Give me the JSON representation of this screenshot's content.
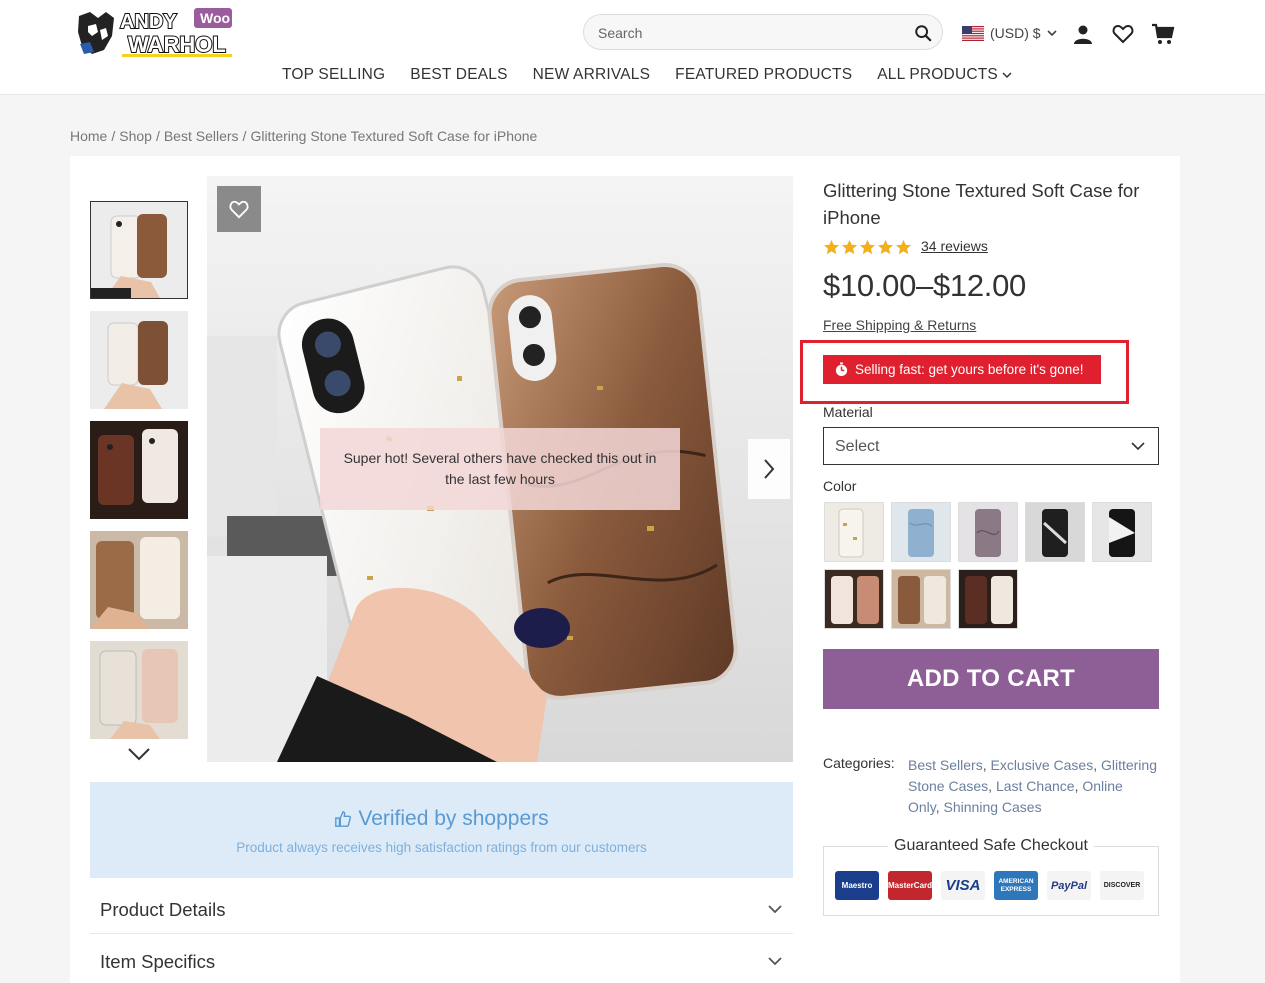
{
  "brand": {
    "logo_line1": "ANDY",
    "logo_line2": "WARHOL",
    "logo_badge": "Woo"
  },
  "header": {
    "search_placeholder": "Search",
    "currency_label": "(USD) $",
    "icons": [
      "search-icon",
      "flag-us-icon",
      "chevron-down-icon",
      "user-icon",
      "heart-icon",
      "cart-icon"
    ]
  },
  "nav": {
    "items": [
      {
        "label": "TOP SELLING"
      },
      {
        "label": "BEST DEALS"
      },
      {
        "label": "NEW ARRIVALS"
      },
      {
        "label": "FEATURED PRODUCTS"
      },
      {
        "label": "ALL PRODUCTS"
      }
    ]
  },
  "breadcrumb": {
    "home": "Home",
    "sep": "/",
    "shop": "Shop",
    "category": "Best Sellers",
    "current": "Glittering Stone Textured Soft Case for iPhone"
  },
  "gallery": {
    "overlay_text": "Super hot! Several others have checked this out in the last few hours"
  },
  "verified": {
    "title": "Verified by shoppers",
    "subtitle": "Product always receives high satisfaction ratings from our customers"
  },
  "accordions": {
    "details": "Product Details",
    "specifics": "Item Specifics"
  },
  "product": {
    "title": "Glittering Stone Textured Soft Case for iPhone",
    "rating": 5,
    "rating_max": 5,
    "reviews": "34 reviews",
    "price": "$10.00–$12.00",
    "shipping_link": "Free Shipping & Returns",
    "urgency": "Selling fast: get yours before it's gone!",
    "material_label": "Material",
    "material_value": "Select",
    "color_label": "Color",
    "add_to_cart": "ADD TO CART",
    "categories_label": "Categories:",
    "categories": [
      {
        "label": "Best Sellers",
        "sep": ", "
      },
      {
        "label": "Exclusive Cases",
        "sep": ", "
      },
      {
        "label": "Glittering Stone Cases",
        "sep": ", "
      },
      {
        "label": "Last Chance",
        "sep": ", "
      },
      {
        "label": "Online Only",
        "sep": ", "
      },
      {
        "label": "Shinning Cases",
        "sep": ""
      }
    ]
  },
  "checkout": {
    "title": "Guaranteed Safe Checkout",
    "cards": [
      {
        "name": "Maestro",
        "color": "#1a3e8c"
      },
      {
        "name": "MasterCard",
        "color": "#c2272d"
      },
      {
        "name": "VISA",
        "color": "#f4f4f4"
      },
      {
        "name": "AMERICAN EXPRESS",
        "color": "#2e77bb"
      },
      {
        "name": "PayPal",
        "color": "#f4f4f4"
      },
      {
        "name": "DISCOVER",
        "color": "#f4f4f4"
      }
    ]
  },
  "colors": {
    "accent_purple": "#8e5e97",
    "urgency_red": "#e0202e",
    "verified_bg": "#dcebf7",
    "verified_text": "#5b9ad1",
    "star_gold": "#f2b01e"
  }
}
